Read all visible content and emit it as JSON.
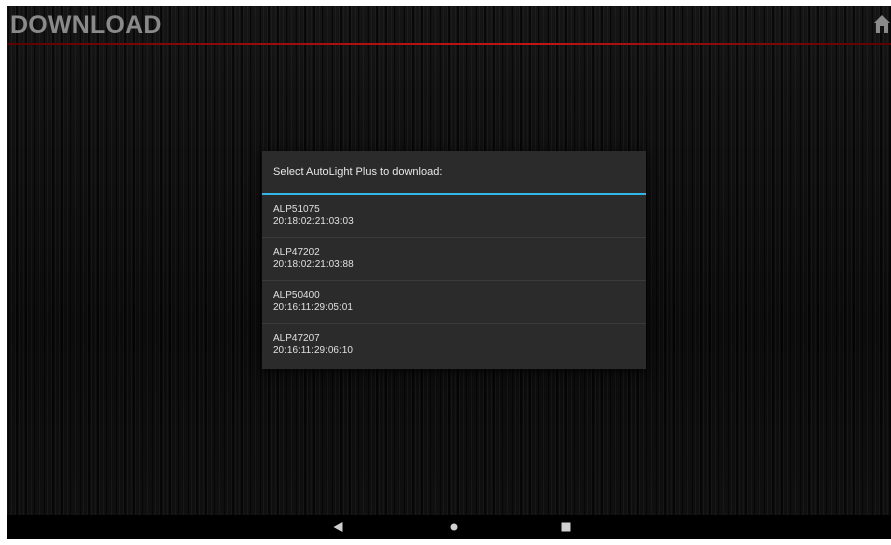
{
  "app": {
    "title": "DOWNLOAD"
  },
  "dialog": {
    "title": "Select AutoLight Plus to download:",
    "items": [
      {
        "name": "ALP51075",
        "address": "20:18:02:21:03:03"
      },
      {
        "name": "ALP47202",
        "address": "20:18:02:21:03:88"
      },
      {
        "name": "ALP50400",
        "address": "20:16:11:29:05:01"
      },
      {
        "name": "ALP47207",
        "address": "20:16:11:29:06:10"
      }
    ]
  },
  "icons": {
    "home": "home-icon",
    "back": "back-triangle-icon",
    "home_nav": "home-circle-icon",
    "recents": "recents-square-icon"
  },
  "colors": {
    "accent_divider": "#33b5e5",
    "appbar_line": "#c01515",
    "title_text": "#8a8a8a",
    "dialog_bg": "#2b2b2b"
  }
}
